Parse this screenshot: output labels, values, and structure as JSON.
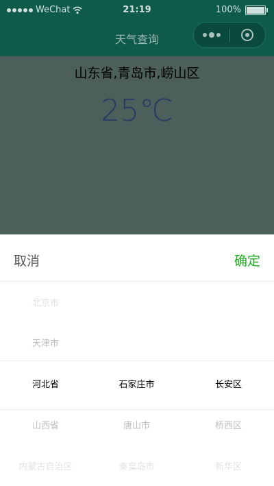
{
  "status_bar": {
    "carrier": "WeChat",
    "time": "21:19",
    "battery": "100%"
  },
  "nav": {
    "title": "天气查询"
  },
  "weather": {
    "location": "山东省,青岛市,崂山区",
    "temperature": "25℃"
  },
  "picker": {
    "cancel_label": "取消",
    "confirm_label": "确定",
    "columns": [
      {
        "options": [
          "北京市",
          "天津市",
          "河北省",
          "山西省",
          "内蒙古自治区"
        ],
        "selected_index": 2
      },
      {
        "options": [
          "",
          "",
          "石家庄市",
          "唐山市",
          "秦皇岛市"
        ],
        "selected_index": 2
      },
      {
        "options": [
          "",
          "",
          "长安区",
          "桥西区",
          "新华区"
        ],
        "selected_index": 2
      }
    ]
  },
  "colors": {
    "nav_bg": "#0e5b4c",
    "mask_bg": "#4d5f5b",
    "temperature": "#263a63",
    "confirm": "#1aad19"
  },
  "icons": {
    "wifi": "wifi-icon",
    "battery": "battery-icon",
    "more": "more-dots-icon",
    "close": "target-close-icon"
  }
}
